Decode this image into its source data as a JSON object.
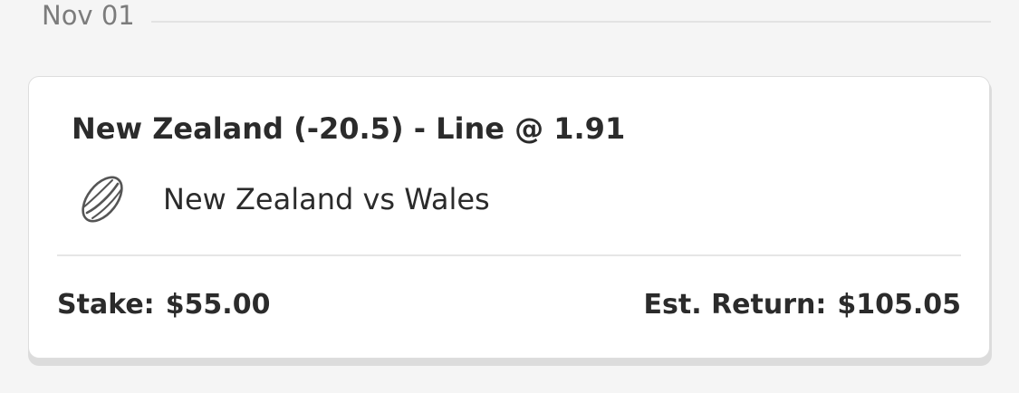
{
  "date_header": {
    "label": "Nov 01"
  },
  "bet": {
    "selection": "New Zealand (-20.5) - Line @ 1.91",
    "sport_icon": "rugby-ball-icon",
    "event": "New Zealand vs Wales",
    "stake_label": "Stake:",
    "stake_value": "$55.00",
    "return_label": "Est. Return:",
    "return_value": "$105.05"
  }
}
